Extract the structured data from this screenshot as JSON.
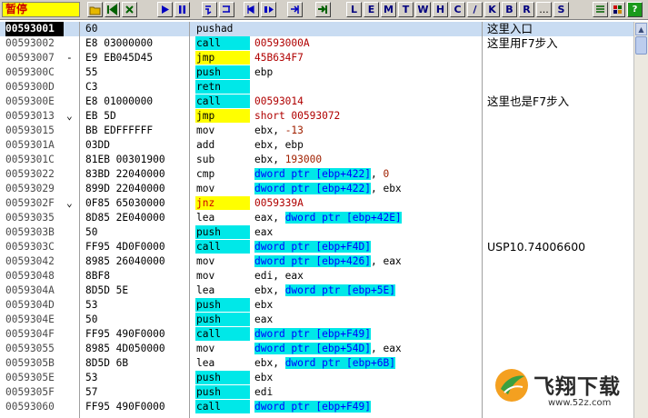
{
  "status": "暂停",
  "toolbar": {
    "groups": [
      {
        "start": 96,
        "buttons": [
          {
            "name": "open-icon",
            "glyph": "",
            "color": "#d4a000"
          },
          {
            "name": "restart-icon",
            "glyph": "",
            "color": "#006000"
          },
          {
            "name": "close-icon",
            "glyph": "",
            "color": "#006000"
          }
        ]
      },
      {
        "start": 173,
        "buttons": [
          {
            "name": "run-icon",
            "glyph": "",
            "color": "#0000c0"
          },
          {
            "name": "pause-icon",
            "glyph": "",
            "color": "#0000c0"
          }
        ]
      },
      {
        "start": 222,
        "buttons": [
          {
            "name": "step-into-icon",
            "glyph": "",
            "color": "#0000c0"
          },
          {
            "name": "step-over-icon",
            "glyph": "",
            "color": "#0000c0"
          }
        ]
      },
      {
        "start": 268,
        "buttons": [
          {
            "name": "trace-into-icon",
            "glyph": "",
            "color": "#0000c0"
          },
          {
            "name": "trace-over-icon",
            "glyph": "",
            "color": "#0000c0"
          }
        ]
      },
      {
        "start": 316,
        "buttons": [
          {
            "name": "execute-till-return-icon",
            "glyph": "",
            "color": "#0000c0"
          }
        ]
      },
      {
        "start": 347,
        "buttons": [
          {
            "name": "go-to-icon",
            "glyph": "",
            "color": "#006000"
          }
        ]
      }
    ],
    "letters": [
      "L",
      "E",
      "M",
      "T",
      "W",
      "H",
      "C",
      "/",
      "K",
      "B",
      "R",
      "...",
      "S"
    ],
    "right_buttons": [
      {
        "name": "list-icon"
      },
      {
        "name": "grid-icon"
      },
      {
        "name": "help-icon",
        "glyph": "?"
      }
    ]
  },
  "rows": [
    {
      "addr": "00593001",
      "mark": "",
      "hex": "60",
      "mn": "pushad",
      "ops": [],
      "comment": "这里入口",
      "sel": true
    },
    {
      "addr": "00593002",
      "mark": "",
      "hex": "E8 03000000",
      "mn": "call",
      "ops": [
        {
          "t": "00593000A",
          "k": "jt"
        }
      ],
      "comment": "这里用F7步入"
    },
    {
      "addr": "00593007",
      "mark": "-",
      "hex": "E9 EB045D45",
      "mn": "jmp",
      "ops": [
        {
          "t": "45B634F7",
          "k": "jt"
        }
      ],
      "comment": ""
    },
    {
      "addr": "0059300C",
      "mark": "",
      "hex": "55",
      "mn": "push",
      "ops": [
        {
          "t": "ebp",
          "k": "txt"
        }
      ],
      "comment": ""
    },
    {
      "addr": "0059300D",
      "mark": "",
      "hex": "C3",
      "mn": "retn",
      "ops": [],
      "comment": ""
    },
    {
      "addr": "0059300E",
      "mark": "",
      "hex": "E8 01000000",
      "mn": "call",
      "ops": [
        {
          "t": "00593014",
          "k": "jt"
        }
      ],
      "comment": "这里也是F7步入"
    },
    {
      "addr": "00593013",
      "mark": "⌄",
      "hex": "EB 5D",
      "mn": "jmp",
      "ops": [
        {
          "t": "short 00593072",
          "k": "jt"
        }
      ],
      "comment": ""
    },
    {
      "addr": "00593015",
      "mark": "",
      "hex": "BB EDFFFFFF",
      "mn": "mov",
      "ops": [
        {
          "t": "ebx, ",
          "k": "txt"
        },
        {
          "t": "-13",
          "k": "num"
        }
      ],
      "comment": ""
    },
    {
      "addr": "0059301A",
      "mark": "",
      "hex": "03DD",
      "mn": "add",
      "ops": [
        {
          "t": "ebx, ebp",
          "k": "txt"
        }
      ],
      "comment": ""
    },
    {
      "addr": "0059301C",
      "mark": "",
      "hex": "81EB 00301900",
      "mn": "sub",
      "ops": [
        {
          "t": "ebx, ",
          "k": "txt"
        },
        {
          "t": "193000",
          "k": "num"
        }
      ],
      "comment": ""
    },
    {
      "addr": "00593022",
      "mark": "",
      "hex": "83BD 22040000",
      "mn": "cmp",
      "ops": [
        {
          "t": "dword ptr [ebp+422]",
          "k": "mem"
        },
        {
          "t": ", ",
          "k": "txt"
        },
        {
          "t": "0",
          "k": "num"
        }
      ],
      "comment": ""
    },
    {
      "addr": "00593029",
      "mark": "",
      "hex": "899D 22040000",
      "mn": "mov",
      "ops": [
        {
          "t": "dword ptr [ebp+422]",
          "k": "mem"
        },
        {
          "t": ", ebx",
          "k": "txt"
        }
      ],
      "comment": ""
    },
    {
      "addr": "0059302F",
      "mark": "⌄",
      "hex": "0F85 65030000",
      "mn": "jnz",
      "ops": [
        {
          "t": "0059339A",
          "k": "jt"
        }
      ],
      "comment": ""
    },
    {
      "addr": "00593035",
      "mark": "",
      "hex": "8D85 2E040000",
      "mn": "lea",
      "ops": [
        {
          "t": "eax, ",
          "k": "txt"
        },
        {
          "t": "dword ptr [ebp+42E]",
          "k": "mem"
        }
      ],
      "comment": ""
    },
    {
      "addr": "0059303B",
      "mark": "",
      "hex": "50",
      "mn": "push",
      "ops": [
        {
          "t": "eax",
          "k": "txt"
        }
      ],
      "comment": ""
    },
    {
      "addr": "0059303C",
      "mark": "",
      "hex": "FF95 4D0F0000",
      "mn": "call",
      "ops": [
        {
          "t": "dword ptr [ebp+F4D]",
          "k": "mem"
        }
      ],
      "comment": "USP10.74006600"
    },
    {
      "addr": "00593042",
      "mark": "",
      "hex": "8985 26040000",
      "mn": "mov",
      "ops": [
        {
          "t": "dword ptr [ebp+426]",
          "k": "mem"
        },
        {
          "t": ", eax",
          "k": "txt"
        }
      ],
      "comment": ""
    },
    {
      "addr": "00593048",
      "mark": "",
      "hex": "8BF8",
      "mn": "mov",
      "ops": [
        {
          "t": "edi, eax",
          "k": "txt"
        }
      ],
      "comment": ""
    },
    {
      "addr": "0059304A",
      "mark": "",
      "hex": "8D5D 5E",
      "mn": "lea",
      "ops": [
        {
          "t": "ebx, ",
          "k": "txt"
        },
        {
          "t": "dword ptr [ebp+5E]",
          "k": "mem"
        }
      ],
      "comment": ""
    },
    {
      "addr": "0059304D",
      "mark": "",
      "hex": "53",
      "mn": "push",
      "ops": [
        {
          "t": "ebx",
          "k": "txt"
        }
      ],
      "comment": ""
    },
    {
      "addr": "0059304E",
      "mark": "",
      "hex": "50",
      "mn": "push",
      "ops": [
        {
          "t": "eax",
          "k": "txt"
        }
      ],
      "comment": ""
    },
    {
      "addr": "0059304F",
      "mark": "",
      "hex": "FF95 490F0000",
      "mn": "call",
      "ops": [
        {
          "t": "dword ptr [ebp+F49]",
          "k": "mem"
        }
      ],
      "comment": ""
    },
    {
      "addr": "00593055",
      "mark": "",
      "hex": "8985 4D050000",
      "mn": "mov",
      "ops": [
        {
          "t": "dword ptr [ebp+54D]",
          "k": "mem"
        },
        {
          "t": ", eax",
          "k": "txt"
        }
      ],
      "comment": ""
    },
    {
      "addr": "0059305B",
      "mark": "",
      "hex": "8D5D 6B",
      "mn": "lea",
      "ops": [
        {
          "t": "ebx, ",
          "k": "txt"
        },
        {
          "t": "dword ptr [ebp+6B]",
          "k": "mem"
        }
      ],
      "comment": ""
    },
    {
      "addr": "0059305E",
      "mark": "",
      "hex": "53",
      "mn": "push",
      "ops": [
        {
          "t": "ebx",
          "k": "txt"
        }
      ],
      "comment": ""
    },
    {
      "addr": "0059305F",
      "mark": "",
      "hex": "57",
      "mn": "push",
      "ops": [
        {
          "t": "edi",
          "k": "txt"
        }
      ],
      "comment": ""
    },
    {
      "addr": "00593060",
      "mark": "",
      "hex": "FF95 490F0000",
      "mn": "call",
      "ops": [
        {
          "t": "dword ptr [ebp+F49]",
          "k": "mem"
        }
      ],
      "comment": ""
    }
  ],
  "watermark": {
    "text": "飞翔下载",
    "url": "www.52z.com"
  }
}
